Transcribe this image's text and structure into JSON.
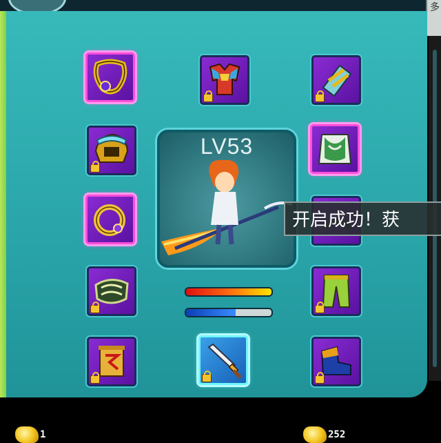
{
  "header": {
    "tab_glyph": "多"
  },
  "character": {
    "level": "LV53",
    "hp_fraction": 1.0,
    "mp_fraction": 0.58
  },
  "equipment": {
    "left": [
      {
        "name": "necklace",
        "quality": "pink",
        "locked": false
      },
      {
        "name": "helmet",
        "quality": "normal",
        "locked": true
      },
      {
        "name": "ring",
        "quality": "pink",
        "locked": false
      },
      {
        "name": "belt",
        "quality": "normal",
        "locked": true
      },
      {
        "name": "scroll",
        "quality": "normal",
        "locked": true
      }
    ],
    "center": [
      {
        "name": "armor",
        "quality": "normal",
        "locked": true
      },
      {
        "name": "weapon",
        "quality": "cyan",
        "locked": true
      }
    ],
    "right": [
      {
        "name": "bracer",
        "quality": "normal",
        "locked": true
      },
      {
        "name": "cloak",
        "quality": "pink",
        "locked": false
      },
      {
        "name": "hidden-item",
        "quality": "normal",
        "locked": false
      },
      {
        "name": "pants",
        "quality": "normal",
        "locked": true
      },
      {
        "name": "boots",
        "quality": "normal",
        "locked": true
      }
    ]
  },
  "toast": {
    "message": "开启成功！获"
  },
  "currency": {
    "left_amount": "1",
    "right_amount": "252"
  },
  "colors": {
    "panel": "#2aa6aa",
    "slot_purple": "#7a22c4",
    "pink_frame": "#ff4ed8",
    "cyan_frame": "#6ff6ff",
    "gold": "#f1c21b"
  }
}
